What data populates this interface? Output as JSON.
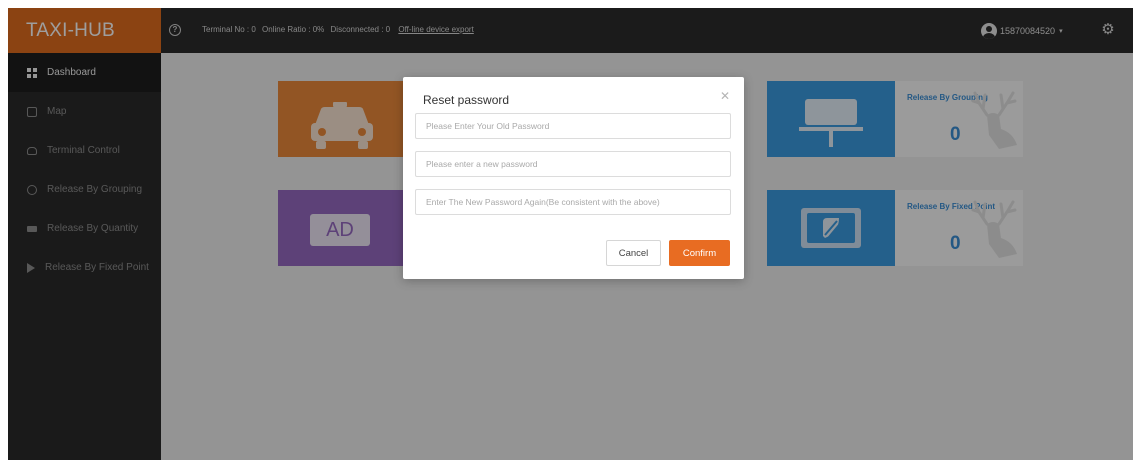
{
  "brand": {
    "name": "TAXI-HUB",
    "color": "#e06c1e"
  },
  "topbar": {
    "help_icon": "question-circle-icon",
    "terminal_no": "Terminal No : 0",
    "online_ratio": "Online Ratio : 0%",
    "disconnected": "Disconnected : 0",
    "export_link": "Off-line device export",
    "user_phone": "15870084520",
    "caret": "▾",
    "settings_icon": "gear-icon"
  },
  "sidebar": {
    "items": [
      {
        "label": "Dashboard",
        "icon": "dashboard-icon",
        "active": true
      },
      {
        "label": "Map",
        "icon": "map-icon"
      },
      {
        "label": "Terminal Control",
        "icon": "car-icon"
      },
      {
        "label": "Release By Grouping",
        "icon": "grouping-icon"
      },
      {
        "label": "Release By Quantity",
        "icon": "quantity-icon"
      },
      {
        "label": "Release By Fixed Point",
        "icon": "play-icon"
      }
    ]
  },
  "cards": [
    {
      "tile_icon": "taxi-icon",
      "color": "#ec8a3a"
    },
    {
      "tile_icon": "ad-icon",
      "tile_text": "AD",
      "color": "#9669c2"
    },
    {
      "title": "Release By Grouping",
      "count": "0",
      "tile_icon": "billboard-icon",
      "color": "#3b9be0"
    },
    {
      "title": "Release By Fixed Point",
      "count": "0",
      "tile_icon": "fixed-point-screen-icon",
      "color": "#3b9be0"
    }
  ],
  "modal": {
    "title": "Reset password",
    "close_icon": "close-icon",
    "old_password_placeholder": "Please Enter Your Old Password",
    "new_password_placeholder": "Please enter a new password",
    "confirm_password_placeholder": "Enter The New Password Again(Be consistent with the above)",
    "cancel_label": "Cancel",
    "confirm_label": "Confirm",
    "confirm_color": "#e86c22"
  }
}
